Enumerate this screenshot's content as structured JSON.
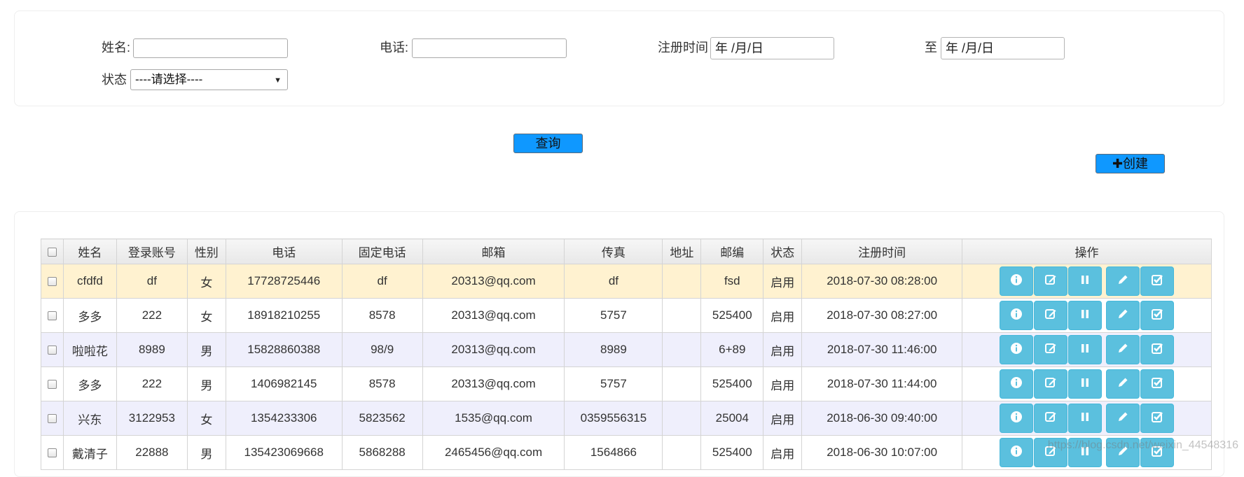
{
  "search": {
    "name_label": "姓名:",
    "name_value": "",
    "phone_label": "电话:",
    "phone_value": "",
    "reg_time_label": "注册时间",
    "reg_time_from": "年 /月/日",
    "to_label": "至",
    "reg_time_to": "年 /月/日",
    "status_label": "状态",
    "status_selected": "----请选择----",
    "query_button": "查询"
  },
  "toolbar": {
    "create_button": "✚创建"
  },
  "table": {
    "headers": [
      "姓名",
      "登录账号",
      "性别",
      "电话",
      "固定电话",
      "邮箱",
      "传真",
      "地址",
      "邮编",
      "状态",
      "注册时间",
      "操作"
    ],
    "rows": [
      [
        "cfdfd",
        "df",
        "女",
        "17728725446",
        "df",
        "20313@qq.com",
        "df",
        "",
        "fsd",
        "启用",
        "2018-07-30 08:28:00"
      ],
      [
        "多多",
        "222",
        "女",
        "18918210255",
        "8578",
        "20313@qq.com",
        "5757",
        "",
        "525400",
        "启用",
        "2018-07-30 08:27:00"
      ],
      [
        "啦啦花",
        "8989",
        "男",
        "15828860388",
        "98/9",
        "20313@qq.com",
        "8989",
        "",
        "6+89",
        "启用",
        "2018-07-30 11:46:00"
      ],
      [
        "多多",
        "222",
        "男",
        "1406982145",
        "8578",
        "20313@qq.com",
        "5757",
        "",
        "525400",
        "启用",
        "2018-07-30 11:44:00"
      ],
      [
        "兴东",
        "3122953",
        "女",
        "1354233306",
        "5823562",
        "1535@qq.com",
        "0359556315",
        "",
        "25004",
        "启用",
        "2018-06-30 09:40:00"
      ],
      [
        "戴清子",
        "22888",
        "男",
        "135423069668",
        "5868288",
        "2465456@qq.com",
        "1564866",
        "",
        "525400",
        "启用",
        "2018-06-30 10:07:00"
      ]
    ],
    "row_styles": [
      "hl",
      "wht",
      "alt",
      "wht",
      "alt",
      "wht"
    ],
    "action_icons": [
      "info-icon",
      "edit-square-icon",
      "pause-icon",
      "pencil-icon",
      "check-square-icon"
    ]
  },
  "watermark": "https://blog.csdn.net/weixin_44548316",
  "colors": {
    "accent_blue": "#0f98ff",
    "action_button": "#5bc0de",
    "row_highlight": "#fff2d0",
    "row_alt": "#efeffc"
  }
}
